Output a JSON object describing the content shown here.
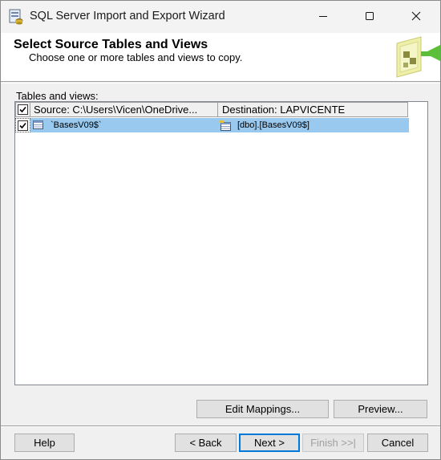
{
  "window": {
    "title": "SQL Server Import and Export Wizard"
  },
  "header": {
    "title": "Select Source Tables and Views",
    "subtitle": "Choose one or more tables and views to copy."
  },
  "tables": {
    "label": "Tables and views:",
    "columns": {
      "source": "Source: C:\\Users\\Vicen\\OneDrive...",
      "destination": "Destination: LAPVICENTE"
    },
    "rows": [
      {
        "checked": true,
        "source": "`BasesV09$`",
        "destination": "[dbo].[BasesV09$]"
      }
    ]
  },
  "buttons": {
    "edit_mappings": "Edit Mappings...",
    "preview": "Preview...",
    "help": "Help",
    "back": "< Back",
    "next": "Next >",
    "finish": "Finish >>|",
    "cancel": "Cancel"
  },
  "icons": {
    "app": "wizard-app-icon",
    "minimize": "minimize-icon",
    "maximize": "maximize-icon",
    "close": "close-icon",
    "header_logo": "wizard-banner-icon",
    "source_row": "table-icon",
    "destination_row": "edit-table-icon"
  },
  "colors": {
    "selection": "#99c9ef",
    "default_button_border": "#0078d7"
  }
}
